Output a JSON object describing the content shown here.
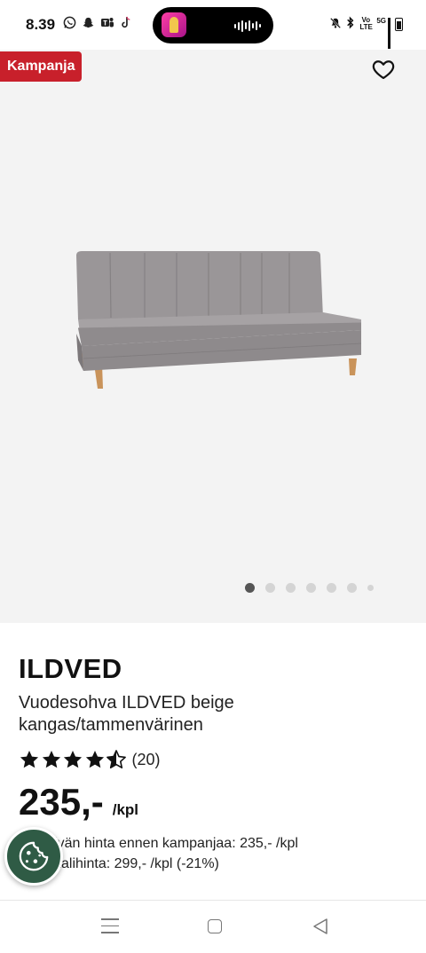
{
  "status_bar": {
    "time": "8.39",
    "app_icons": [
      "whatsapp-icon",
      "snapchat-icon",
      "teams-icon",
      "tiktok-icon"
    ],
    "right_icons": [
      "mute-icon",
      "bluetooth-icon",
      "volte-icon",
      "5g-signal-icon",
      "battery-icon"
    ],
    "volte_label": "Vo LTE",
    "network_label": "5G"
  },
  "gallery": {
    "badge": "Kampanja",
    "badge_color": "#c8202b",
    "image_count": 7,
    "active_index": 0
  },
  "product": {
    "brand": "ILDVED",
    "description": "Vuodesohva ILDVED beige kangas/tammenvärinen",
    "rating": 4.5,
    "rating_count": "(20)",
    "price": "235,-",
    "unit": "/kpl",
    "note1": "30 päivän hinta ennen kampanjaa: 235,- /kpl",
    "note2": "Normaalihinta: 299,- /kpl (-21%)"
  },
  "colors": {
    "accent": "#c8202b",
    "cookie_button": "#2f5b45"
  }
}
